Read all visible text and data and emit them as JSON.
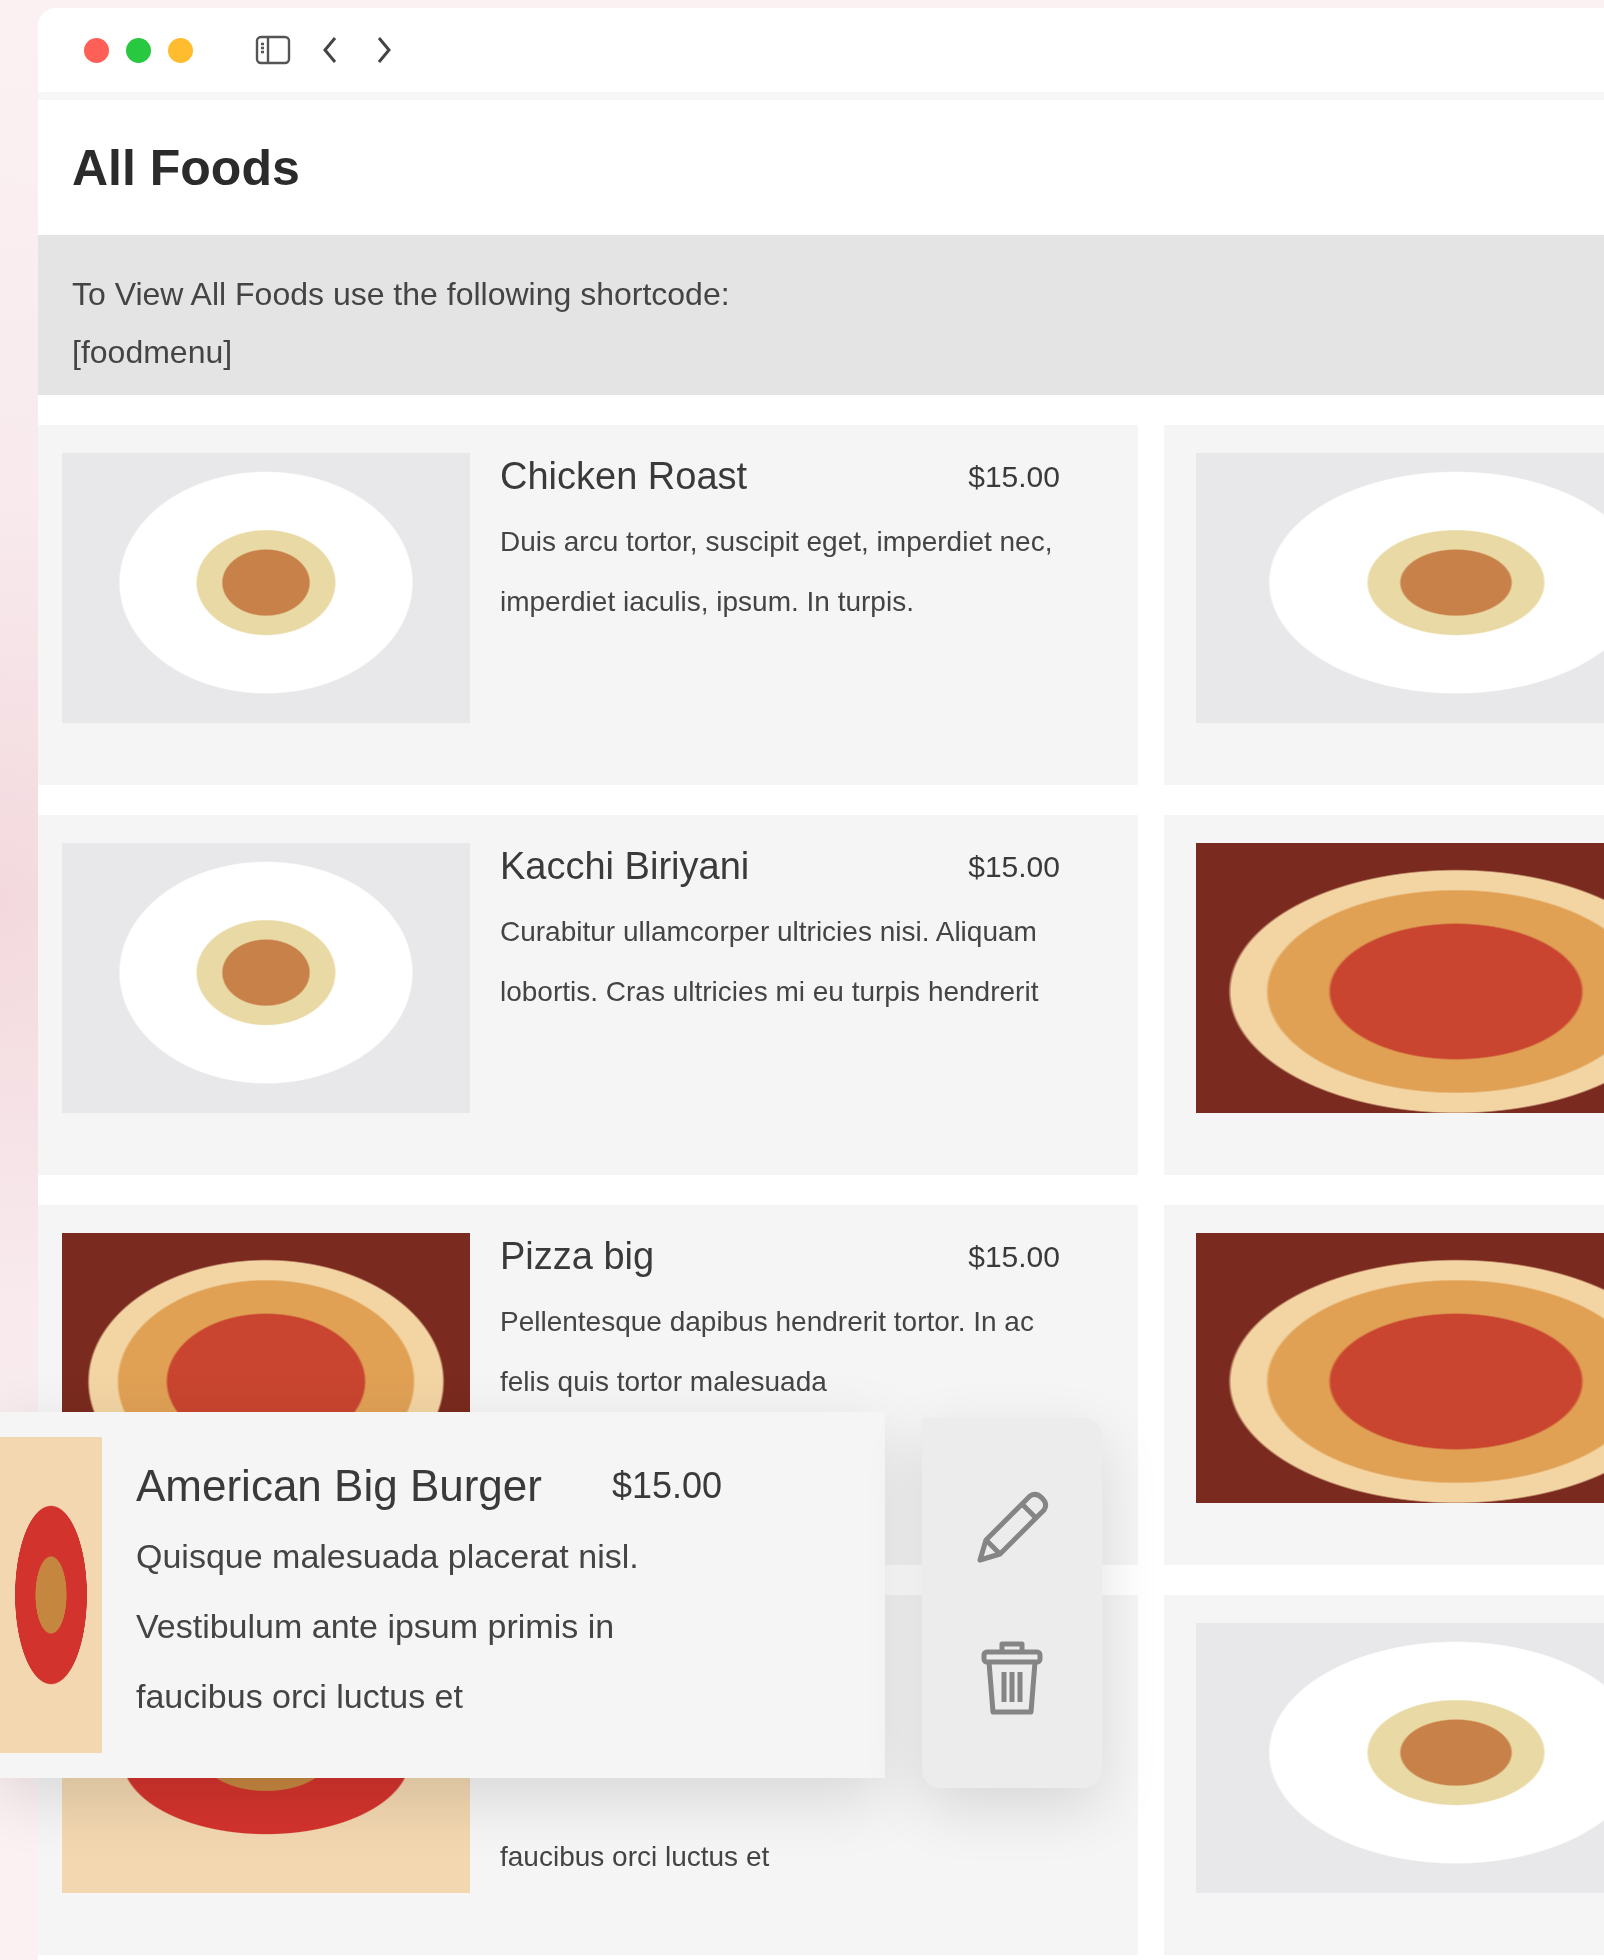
{
  "page": {
    "title": "All Foods",
    "notice": "To View All Foods use the following shortcode:",
    "shortcode": "[foodmenu]"
  },
  "foods": [
    {
      "name": "Chicken Roast",
      "price": "$15.00",
      "description": "Duis arcu tortor, suscipit eget, imperdiet nec, imperdiet iaculis, ipsum. In turpis.",
      "kind": "pasta"
    },
    {
      "name": "Kacchi Biriyani",
      "price": "$15.00",
      "description": "Curabitur ullamcorper ultricies nisi. Aliquam lobortis. Cras ultricies mi eu turpis hendrerit",
      "kind": "pasta"
    },
    {
      "name": "Pizza big",
      "price": "$15.00",
      "description": "Pellentesque dapibus hendrerit tortor. In ac felis quis tortor malesuada",
      "kind": "pizza"
    },
    {
      "description": "faucibus orci luctus et",
      "kind": "burger"
    }
  ],
  "side_foods": [
    {
      "kind": "pasta"
    },
    {
      "kind": "pizza"
    },
    {
      "kind": "pizza"
    },
    {
      "kind": "pasta"
    }
  ],
  "dragged_food": {
    "name": "American Big Burger",
    "price": "$15.00",
    "description": "Quisque malesuada placerat nisl. Vestibulum ante ipsum primis in faucibus orci luctus et",
    "kind": "burger"
  }
}
